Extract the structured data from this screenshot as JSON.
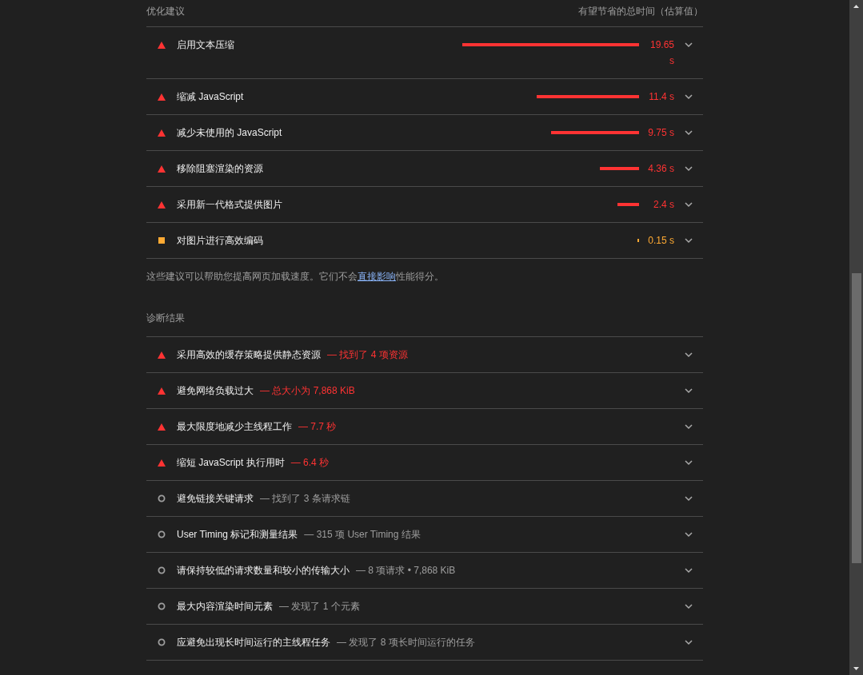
{
  "opportunities": {
    "title": "优化建议",
    "column_header": "有望节省的总时间（估算值）",
    "items": [
      {
        "kind": "fail",
        "title": "启用文本压缩",
        "value": "19.65 s"
      },
      {
        "kind": "fail",
        "title": "缩减 JavaScript",
        "value": "11.4 s"
      },
      {
        "kind": "fail",
        "title": "减少未使用的 JavaScript",
        "value": "9.75 s"
      },
      {
        "kind": "fail",
        "title": "移除阻塞渲染的资源",
        "value": "4.36 s"
      },
      {
        "kind": "fail",
        "title": "采用新一代格式提供图片",
        "value": "2.4 s"
      },
      {
        "kind": "average",
        "title": "对图片进行高效编码",
        "value": "0.15 s"
      }
    ],
    "note": {
      "before": "这些建议可以帮助您提高网页加载速度。它们不会",
      "link": "直接影响",
      "after": "性能得分。"
    }
  },
  "diagnostics": {
    "title": "诊断结果",
    "items": [
      {
        "kind": "fail",
        "title": "采用高效的缓存策略提供静态资源",
        "detail": "— 找到了 4 项资源"
      },
      {
        "kind": "fail",
        "title": "避免网络负载过大",
        "detail": "— 总大小为 7,868 KiB"
      },
      {
        "kind": "fail",
        "title": "最大限度地减少主线程工作",
        "detail": "— 7.7 秒"
      },
      {
        "kind": "fail",
        "title": "缩短 JavaScript 执行用时",
        "detail": "— 6.4 秒"
      },
      {
        "kind": "info",
        "title": "避免链接关键请求",
        "detail": "— 找到了 3 条请求链"
      },
      {
        "kind": "info",
        "title": "User Timing 标记和测量结果",
        "detail": "— 315 项 User Timing 结果"
      },
      {
        "kind": "info",
        "title": "请保持较低的请求数量和较小的传输大小",
        "detail": "— 8 项请求 • 7,868 KiB"
      },
      {
        "kind": "info",
        "title": "最大内容渲染时间元素",
        "detail": "— 发现了 1 个元素"
      },
      {
        "kind": "info",
        "title": "应避免出现长时间运行的主线程任务",
        "detail": "— 发现了 8 项长时间运行的任务"
      }
    ]
  }
}
